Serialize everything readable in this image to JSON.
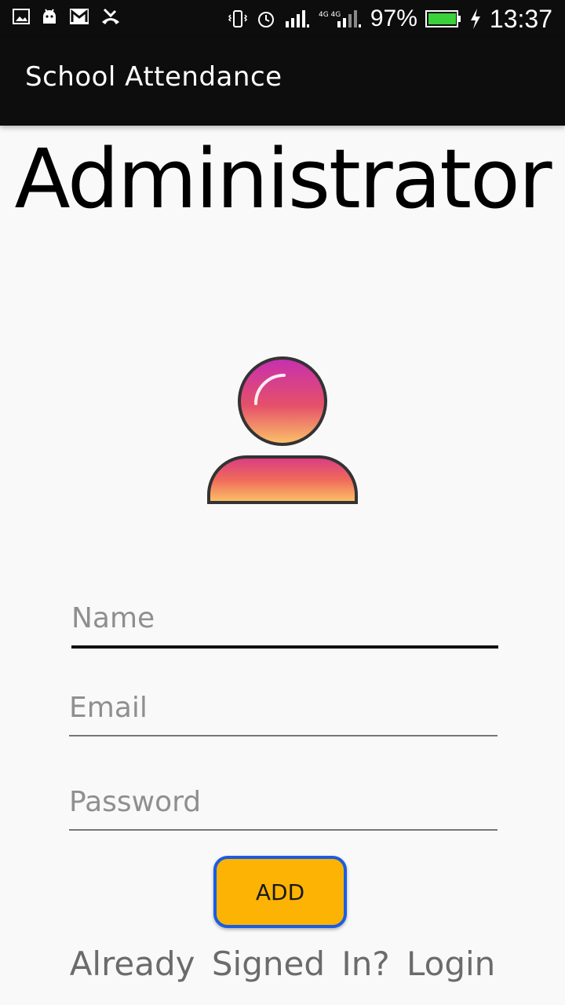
{
  "status_bar": {
    "battery_percent": "97%",
    "time": "13:37",
    "left_icons": [
      "gallery-icon",
      "android-icon",
      "gmail-icon",
      "missed-call-icon"
    ],
    "right_icons": [
      "vibrate-icon",
      "alarm-icon",
      "signal-sim1-icon",
      "signal-sim2-icon",
      "battery-icon",
      "charging-icon"
    ]
  },
  "app_bar": {
    "title": "School Attendance"
  },
  "main": {
    "title": "Administrator",
    "avatar_icon": "user-avatar-icon",
    "fields": {
      "name": {
        "placeholder": "Name",
        "value": ""
      },
      "email": {
        "placeholder": "Email",
        "value": ""
      },
      "password": {
        "placeholder": "Password",
        "value": ""
      }
    },
    "add_button_label": "ADD",
    "login_link": "Already Signed In? Login"
  },
  "colors": {
    "bar_background": "#0d0d0d",
    "page_background": "#f9f9f9",
    "button_fill": "#fdb303",
    "button_border": "#1a5de0",
    "battery_green": "#3ad13a"
  }
}
